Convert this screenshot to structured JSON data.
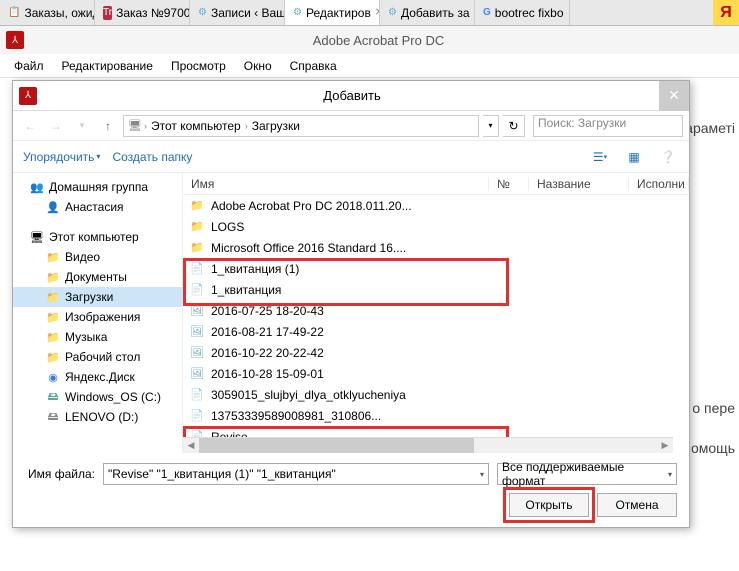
{
  "browser_tabs": [
    {
      "label": "Заказы, ожид",
      "icon": "📋"
    },
    {
      "label": "Заказ №9700",
      "icon": "Tr",
      "icon_bg": "#b03040"
    },
    {
      "label": "Записи ‹ Ваш",
      "icon": "⚙"
    },
    {
      "label": "Редактиров",
      "icon": "⚙",
      "active": true,
      "closable": true
    },
    {
      "label": "Добавить за",
      "icon": "⚙"
    },
    {
      "label": "bootrec fixbo",
      "icon": "G"
    }
  ],
  "yandex_icon": "Я",
  "app": {
    "title": "Adobe Acrobat Pro DC"
  },
  "menu": [
    "Файл",
    "Редактирование",
    "Просмотр",
    "Окно",
    "Справка"
  ],
  "dialog": {
    "title": "Добавить",
    "path": [
      "Этот компьютер",
      "Загрузки"
    ],
    "search_placeholder": "Поиск: Загрузки",
    "organize": "Упорядочить",
    "new_folder": "Создать папку",
    "cols": {
      "name": "Имя",
      "no": "№",
      "title": "Название",
      "perf": "Исполни"
    },
    "filename_label": "Имя файла:",
    "filename_value": "\"Revise\" \"1_квитанция (1)\" \"1_квитанция\"",
    "filter": "Все поддерживаемые формат",
    "open": "Открыть",
    "cancel": "Отмена"
  },
  "nav": {
    "homegroup": "Домашняя группа",
    "user": "Анастасия",
    "this_pc": "Этот компьютер",
    "video": "Видео",
    "documents": "Документы",
    "downloads": "Загрузки",
    "pictures": "Изображения",
    "music": "Музыка",
    "desktop": "Рабочий стол",
    "yadisk": "Яндекс.Диск",
    "win_os": "Windows_OS (C:)",
    "lenovo": "LENOVO (D:)"
  },
  "files": [
    {
      "name": "Adobe Acrobat Pro DC 2018.011.20...",
      "icon": "folder"
    },
    {
      "name": "LOGS",
      "icon": "folder"
    },
    {
      "name": "Microsoft Office 2016 Standard 16....",
      "icon": "folder"
    },
    {
      "name": "1_квитанция (1)",
      "icon": "pdf"
    },
    {
      "name": "1_квитанция",
      "icon": "pdf"
    },
    {
      "name": "2016-07-25 18-20-43",
      "icon": "img"
    },
    {
      "name": "2016-08-21 17-49-22",
      "icon": "img"
    },
    {
      "name": "2016-10-22 20-22-42",
      "icon": "img"
    },
    {
      "name": "2016-10-28 15-09-01",
      "icon": "img"
    },
    {
      "name": "3059015_slujbyi_dlya_otklyucheniya",
      "icon": "file"
    },
    {
      "name": "13753339589008981_310806...",
      "icon": "file"
    },
    {
      "name": "Revise",
      "icon": "pdf"
    }
  ],
  "bg": {
    "param": "Іараметі",
    "perev": "о пере",
    "omo": "омощь"
  }
}
